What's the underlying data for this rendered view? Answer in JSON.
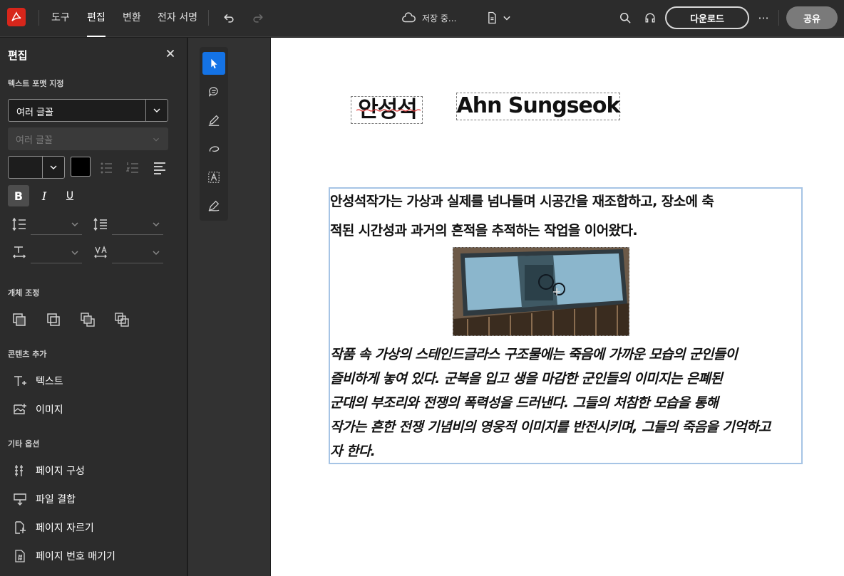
{
  "topbar": {
    "tabs": [
      "도구",
      "편집",
      "변환",
      "전자 서명"
    ],
    "active_tab": "편집",
    "save_status": "저장 중...",
    "download_label": "다운로드",
    "share_label": "공유",
    "more_label": "···"
  },
  "left_panel": {
    "title": "편집",
    "text_format_label": "텍스트 포맷 지정",
    "font_select_value": "여러 글꼴",
    "font_style_placeholder": "여러 글꼴",
    "bold_label": "B",
    "italic_label": "I",
    "underline_label": "U",
    "object_section_label": "개체 조정",
    "content_section_label": "콘텐츠 추가",
    "add_text_label": "텍스트",
    "add_image_label": "이미지",
    "other_section_label": "기타 옵션",
    "other_items": [
      "페이지 구성",
      "파일 결합",
      "페이지 자르기",
      "페이지 번호 매기기"
    ],
    "colors": {
      "font_color": "#000000",
      "accent": "#1473e6"
    }
  },
  "document": {
    "title_ko": "안성석",
    "title_en": "Ahn Sungseok",
    "paragraph1": [
      "   안성석작가는  가상과 실제를 넘나들며 시공간을 재조합하고, 장소에 축",
      "적된 시간성과 과거의 흔적을 추적하는 작업을 이어왔다."
    ],
    "paragraph2": [
      "   작품 속 가상의 스테인드글라스 구조물에는 죽음에 가까운 모습의 군인들이",
      "즐비하게 놓여 있다. 군복을 입고 생을 마감한 군인들의 이미지는 은폐된",
      "군대의 부조리와 전쟁의  폭력성을 드러낸다. 그들의 처참한 모습을 통해",
      "작가는 흔한 전쟁 기념비의 영웅적 이미지를 반전시키며, 그들의 죽음을 기억하고",
      "자 한다."
    ]
  }
}
